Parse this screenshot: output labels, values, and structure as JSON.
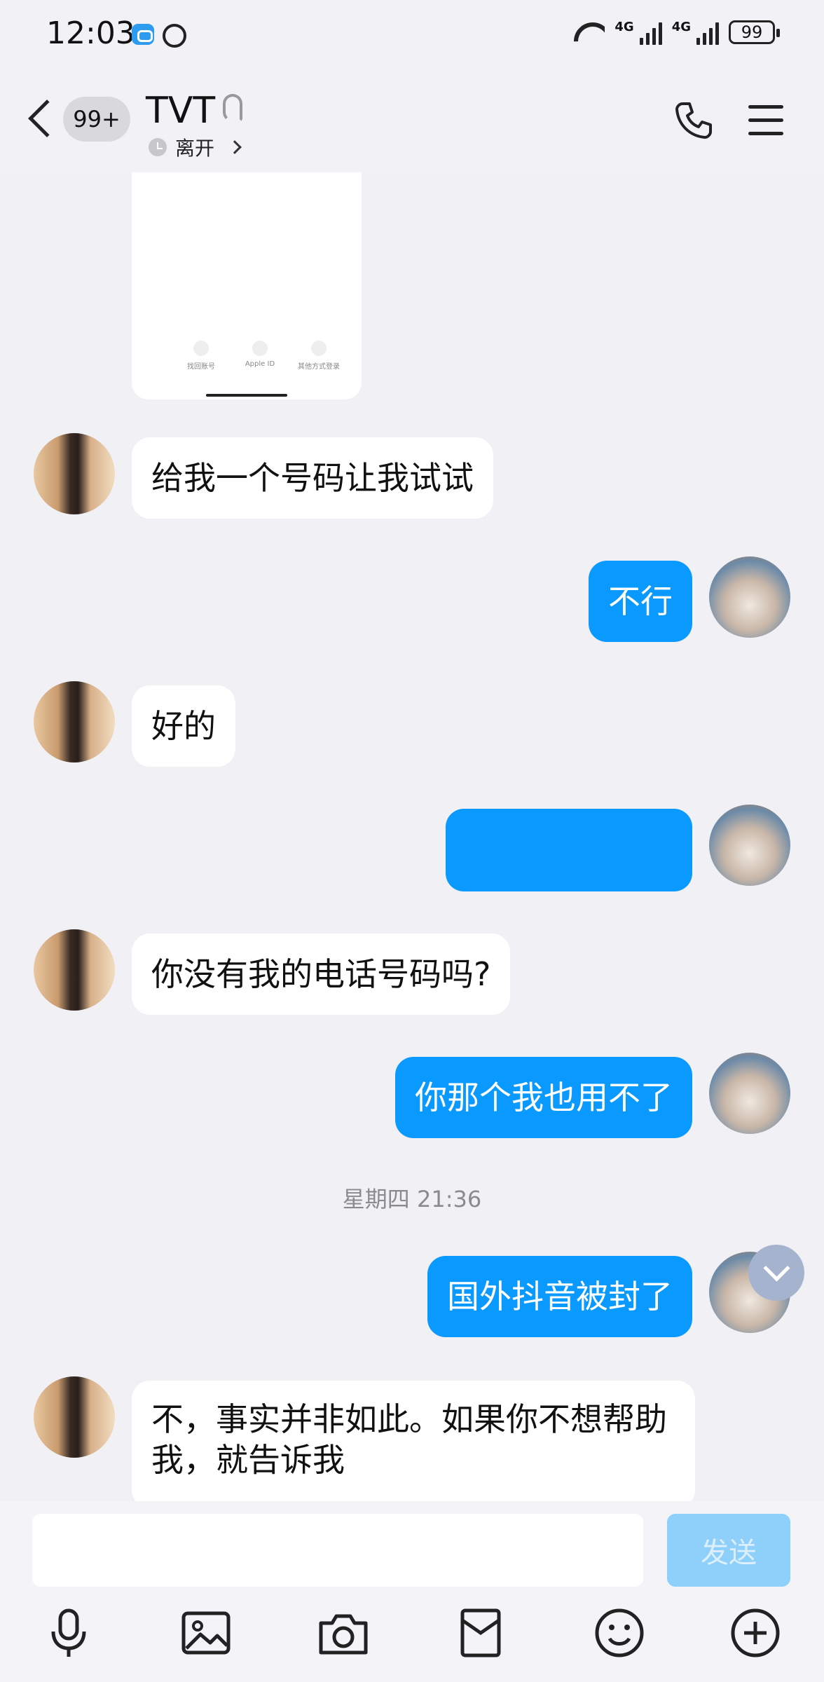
{
  "status_bar": {
    "time": "12:03",
    "network_1": "4G",
    "network_2": "4G",
    "battery": "99"
  },
  "header": {
    "unread_count": "99+",
    "title": "TVT",
    "status": "离开"
  },
  "image_message": {
    "options": [
      "找回账号",
      "Apple ID",
      "其他方式登录"
    ]
  },
  "messages": [
    {
      "side": "in",
      "text": "给我一个号码让我试试"
    },
    {
      "side": "out",
      "text": "不行"
    },
    {
      "side": "in",
      "text": "好的"
    },
    {
      "side": "out",
      "text": "(blurred)",
      "blurred": true
    },
    {
      "side": "in",
      "text": "你没有我的电话号码吗?"
    },
    {
      "side": "out",
      "text": "你那个我也用不了"
    },
    {
      "side": "out",
      "text": "国外抖音被封了"
    },
    {
      "side": "in",
      "text": "不，事实并非如此。如果你不想帮助我，就告诉我"
    }
  ],
  "timestamp": "星期四 21:36",
  "input": {
    "value": "",
    "send_label": "发送"
  },
  "colors": {
    "outgoing_bubble": "#0a99ff",
    "incoming_bubble": "#ffffff",
    "background": "#f0f0f5",
    "send_button_disabled": "#8fd0fb"
  },
  "toolbar_icons": [
    "microphone-icon",
    "image-icon",
    "camera-icon",
    "red-packet-icon",
    "emoji-icon",
    "plus-icon"
  ]
}
